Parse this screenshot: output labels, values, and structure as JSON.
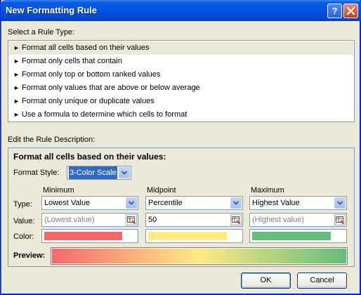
{
  "window": {
    "title": "New Formatting Rule"
  },
  "rule_type": {
    "label": "Select a Rule Type:",
    "items": [
      "Format all cells based on their values",
      "Format only cells that contain",
      "Format only top or bottom ranked values",
      "Format only values that are above or below average",
      "Format only unique or duplicate values",
      "Use a formula to determine which cells to format"
    ],
    "selected_index": 0
  },
  "description": {
    "label": "Edit the Rule Description:",
    "heading": "Format all cells based on their values:",
    "format_style_label": "Format Style:",
    "format_style_value": "3-Color Scale",
    "row_labels": {
      "type": "Type:",
      "value": "Value:",
      "color": "Color:"
    },
    "columns": [
      {
        "header": "Minimum",
        "type": "Lowest Value",
        "value": "(Lowest value)",
        "color": "#f8696b"
      },
      {
        "header": "Midpoint",
        "type": "Percentile",
        "value": "50",
        "color": "#ffeb84"
      },
      {
        "header": "Maximum",
        "type": "Highest Value",
        "value": "(Highest value)",
        "color": "#63be7b"
      }
    ],
    "preview_label": "Preview:"
  },
  "buttons": {
    "ok": "OK",
    "cancel": "Cancel"
  },
  "colors": {
    "title_bar": "#0055e5",
    "dialog_bg": "#ece9d8",
    "selection": "#316ac5"
  }
}
